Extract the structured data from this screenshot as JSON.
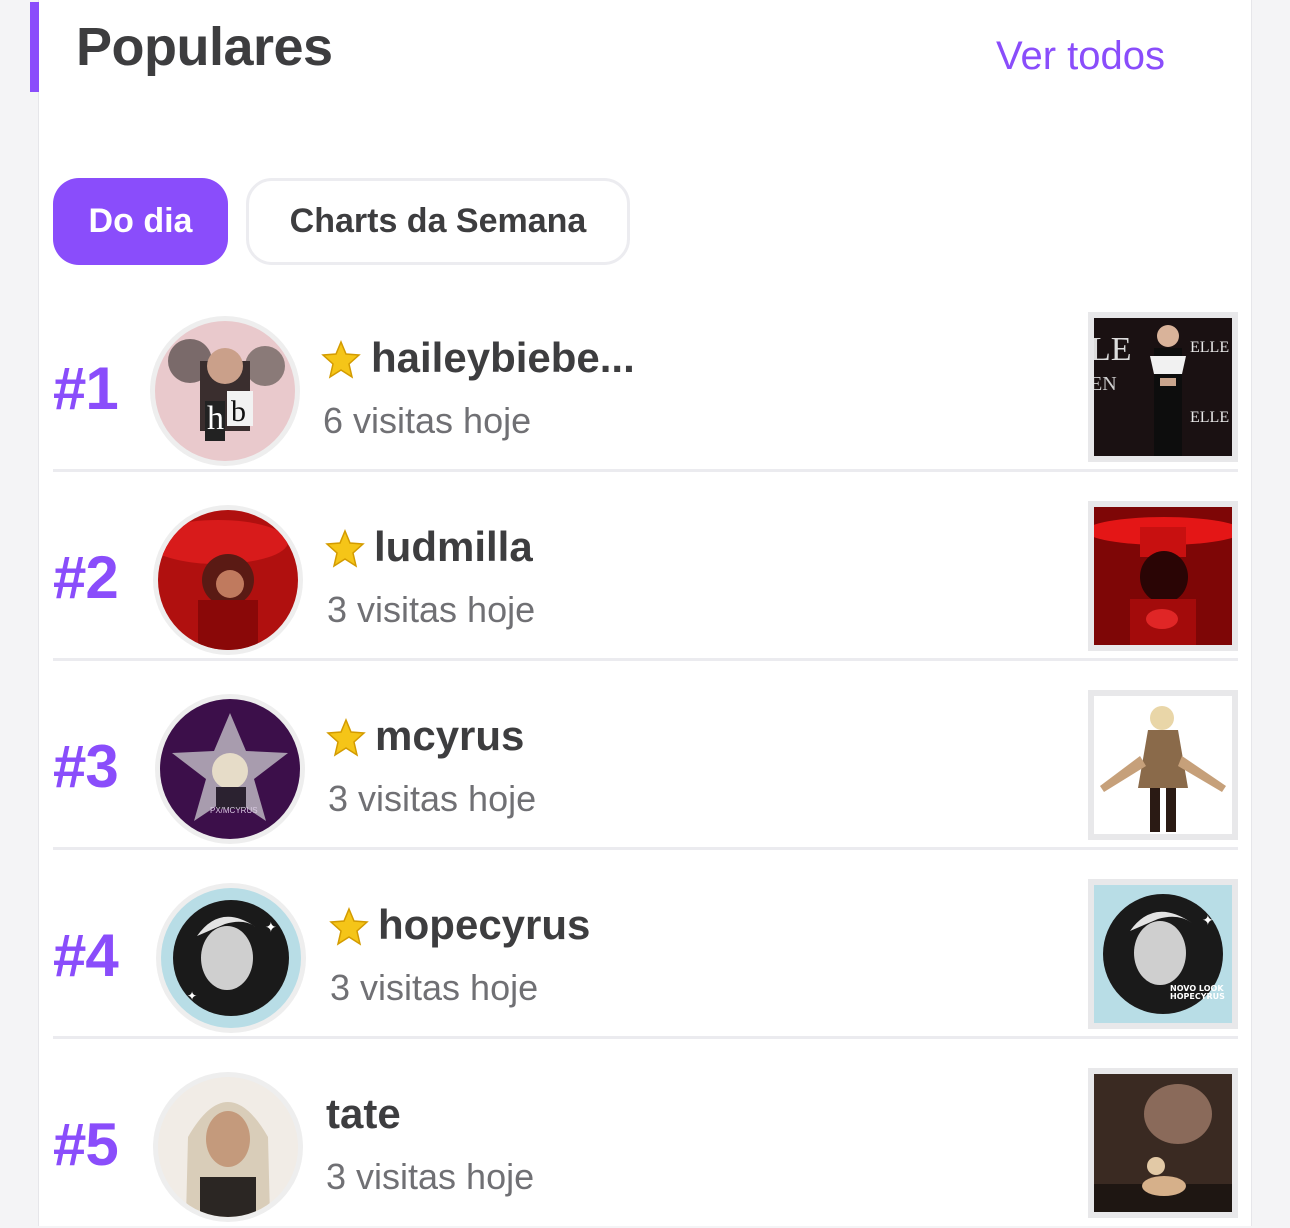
{
  "header": {
    "title": "Populares",
    "see_all": "Ver todos"
  },
  "tabs": [
    {
      "label": "Do dia",
      "active": true
    },
    {
      "label": "Charts da Semana",
      "active": false
    }
  ],
  "ranking": [
    {
      "rank": "#1",
      "name": "haileybiebe...",
      "visits": "6 visitas hoje",
      "verified": true
    },
    {
      "rank": "#2",
      "name": "ludmilla",
      "visits": "3 visitas hoje",
      "verified": true
    },
    {
      "rank": "#3",
      "name": "mcyrus",
      "visits": "3 visitas hoje",
      "verified": true
    },
    {
      "rank": "#4",
      "name": "hopecyrus",
      "visits": "3 visitas hoje",
      "verified": true
    },
    {
      "rank": "#5",
      "name": "tate",
      "visits": "3 visitas hoje",
      "verified": false
    }
  ],
  "colors": {
    "accent": "#8a4dfb",
    "star": "#f5c518"
  }
}
